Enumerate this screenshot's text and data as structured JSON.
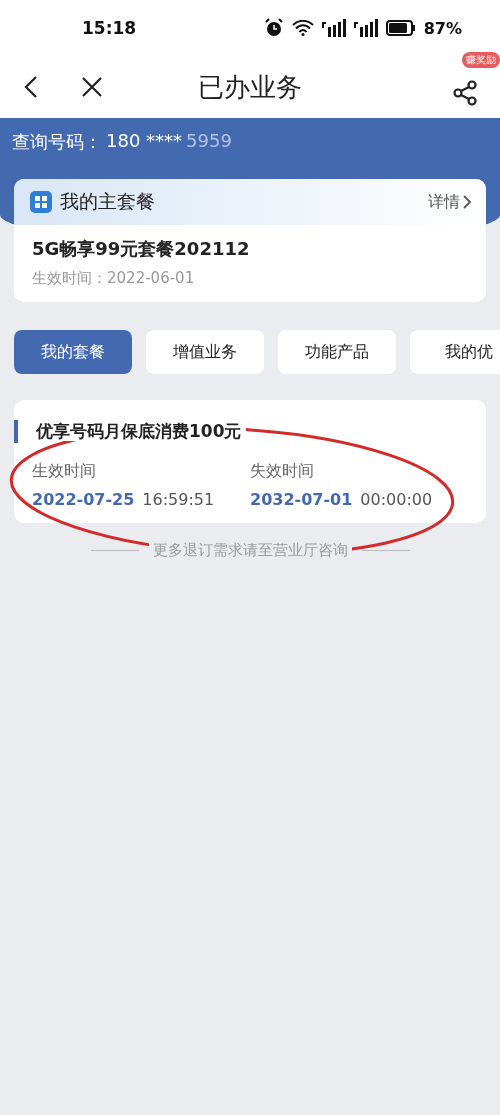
{
  "status_bar": {
    "time": "15:18",
    "battery": "87%"
  },
  "nav": {
    "title": "已办业务",
    "badge": "赚奖励"
  },
  "query": {
    "label": "查询号码：",
    "number": "180 ****",
    "number_faded": "5959"
  },
  "main_plan": {
    "heading": "我的主套餐",
    "detail_link": "详情",
    "name": "5G畅享99元套餐202112",
    "effective": "生效时间：2022-06-01"
  },
  "tabs": [
    {
      "label": "我的套餐",
      "selected": true
    },
    {
      "label": "增值业务",
      "selected": false
    },
    {
      "label": "功能产品",
      "selected": false
    },
    {
      "label": "我的优",
      "selected": false
    }
  ],
  "packages": [
    {
      "title": "优享号码月保底消费100元",
      "start_label": "生效时间",
      "start_date": "2022-07-25",
      "start_time": "16:59:51",
      "end_label": "失效时间",
      "end_date": "2032-07-01",
      "end_time": "00:00:00",
      "circled": true
    }
  ],
  "footer_note": "更多退订需求请至营业厅咨询"
}
